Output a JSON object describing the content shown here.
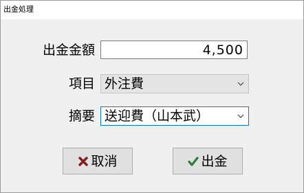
{
  "window": {
    "title": "出金処理"
  },
  "form": {
    "amount": {
      "label": "出金金額",
      "value": "4,500"
    },
    "item": {
      "label": "項目",
      "value": "外注費"
    },
    "summary": {
      "label": "摘要",
      "value": "送迎費（山本武）"
    }
  },
  "buttons": {
    "cancel": {
      "label": "取消",
      "icon": "x-mark-icon",
      "icon_color": "#8b1a1a"
    },
    "withdraw": {
      "label": "出金",
      "icon": "checkmark-icon",
      "icon_color": "#2e7d32"
    }
  },
  "colors": {
    "focus_border": "#0078d7",
    "dialog_background": "#f0f0f0"
  }
}
